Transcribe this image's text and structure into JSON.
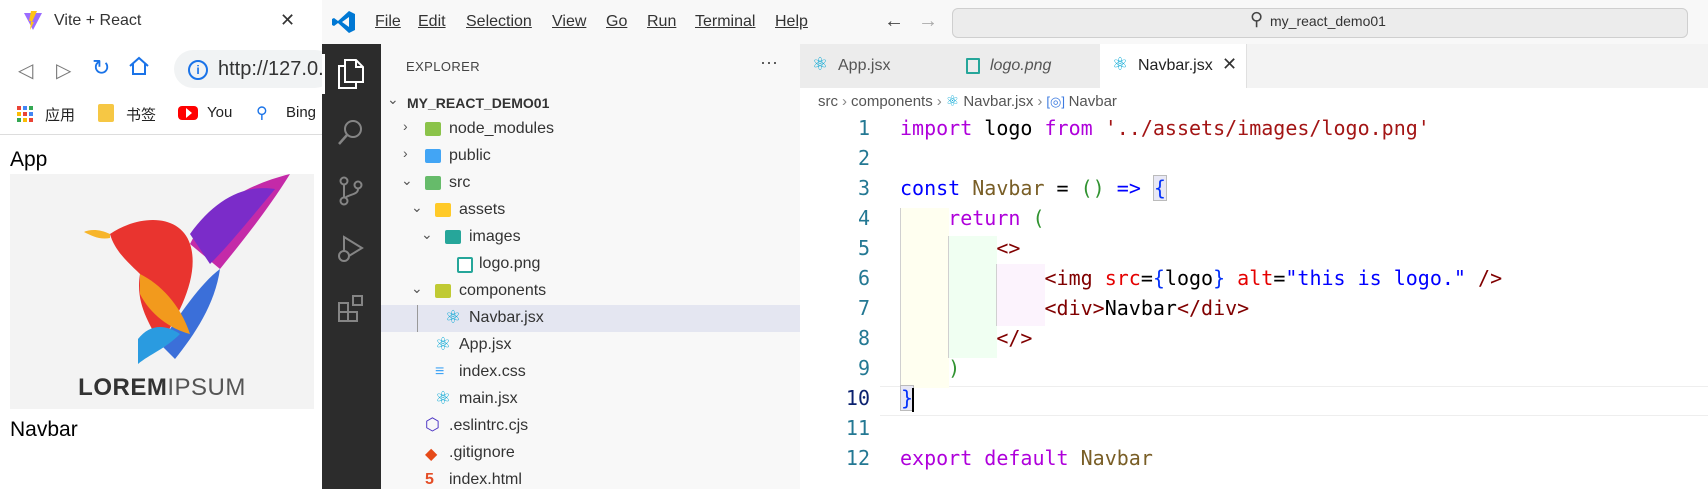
{
  "browser": {
    "tab_title": "Vite + React",
    "url": "http://127.0.",
    "bookmarks": [
      "应用",
      "书签",
      "You",
      "Bing"
    ],
    "page": {
      "app_text": "App",
      "logo_word1": "LOREM",
      "logo_word2": "IPSUM",
      "navbar_text": "Navbar"
    }
  },
  "vscode": {
    "menu": [
      "File",
      "Edit",
      "Selection",
      "View",
      "Go",
      "Run",
      "Terminal",
      "Help"
    ],
    "command_center": "my_react_demo01",
    "explorer_title": "EXPLORER",
    "project_root": "MY_REACT_DEMO01",
    "tree": [
      {
        "label": "node_modules"
      },
      {
        "label": "public"
      },
      {
        "label": "src"
      },
      {
        "label": "assets"
      },
      {
        "label": "images"
      },
      {
        "label": "logo.png"
      },
      {
        "label": "components"
      },
      {
        "label": "Navbar.jsx"
      },
      {
        "label": "App.jsx"
      },
      {
        "label": "index.css"
      },
      {
        "label": "main.jsx"
      },
      {
        "label": ".eslintrc.cjs"
      },
      {
        "label": ".gitignore"
      },
      {
        "label": "index.html"
      }
    ],
    "tabs": [
      "App.jsx",
      "logo.png",
      "Navbar.jsx"
    ],
    "active_tab": "Navbar.jsx",
    "breadcrumb": [
      "src",
      "components",
      "Navbar.jsx",
      "Navbar"
    ],
    "line_numbers": [
      "1",
      "2",
      "3",
      "4",
      "5",
      "6",
      "7",
      "8",
      "9",
      "10",
      "11",
      "12"
    ],
    "code": {
      "l1_import": "import",
      "l1_logo": " logo ",
      "l1_from": "from",
      "l1_path": " '../assets/images/logo.png'",
      "l3_const": "const",
      "l3_name": " Navbar",
      "l3_eq": " = ",
      "l3_parens": "()",
      "l3_arrow": " => ",
      "l3_brace": "{",
      "l4_return": "    return",
      "l4_paren": " (",
      "l5_frag": "        <>",
      "l6_open": "            <img ",
      "l6_src": "src",
      "l6_eq": "=",
      "l6_lb": "{",
      "l6_logo": "logo",
      "l6_rb": "}",
      "l6_alt": " alt",
      "l6_eq2": "=",
      "l6_val": "\"this is logo.\"",
      "l6_close": " />",
      "l7_open": "            <div>",
      "l7_text": "Navbar",
      "l7_close": "</div>",
      "l8_frag": "        </>",
      "l9_paren": "    )",
      "l10_brace": "}",
      "l12_export": "export",
      "l12_default": " default",
      "l12_name": " Navbar"
    }
  }
}
